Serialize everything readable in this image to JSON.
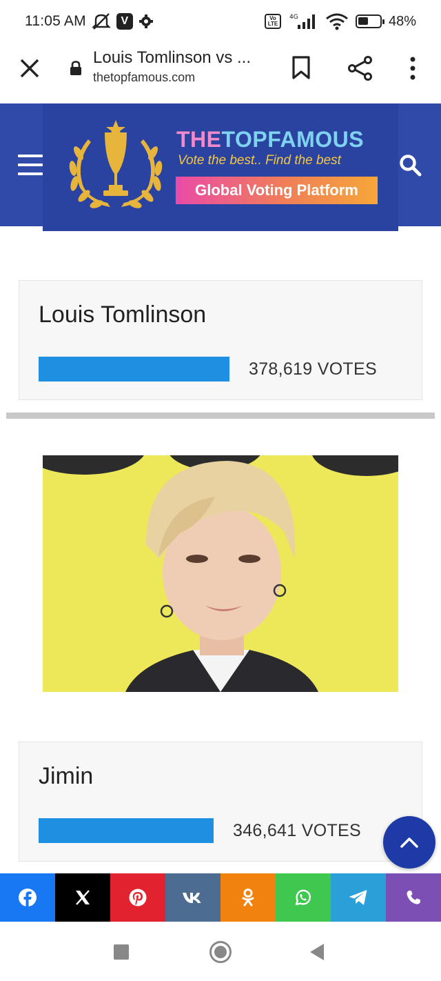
{
  "status_bar": {
    "time": "11:05 AM",
    "network": "4G",
    "battery": "48%",
    "battery_level": 0.48,
    "icons": [
      "mute-icon",
      "v-app-icon",
      "settings-icon",
      "volte-icon",
      "signal-icon",
      "wifi-icon",
      "battery-icon"
    ]
  },
  "browser": {
    "page_title": "Louis Tomlinson vs ...",
    "domain": "thetopfamous.com",
    "icons": [
      "close-icon",
      "lock-icon",
      "bookmark-icon",
      "share-icon",
      "more-vert-icon"
    ]
  },
  "site_header": {
    "brand_the": "THE",
    "brand_rest": "TOPFAMOUS",
    "tagline": "Vote the best.. Find the best",
    "badge": "Global Voting Platform",
    "colors": {
      "header_bg": "#2f4aa8",
      "vote_bar": "#1e8fe1"
    }
  },
  "contestants": [
    {
      "name": "Louis Tomlinson",
      "votes": "378,619 VOTES",
      "bar_fraction": 1.0
    },
    {
      "name": "Jimin",
      "votes": "346,641 VOTES",
      "bar_fraction": 0.9155
    }
  ],
  "share_bar": [
    {
      "name": "facebook",
      "color": "#1877f2"
    },
    {
      "name": "x",
      "color": "#000000"
    },
    {
      "name": "pinterest",
      "color": "#e0232f"
    },
    {
      "name": "vk",
      "color": "#4c6c91"
    },
    {
      "name": "odnoklassniki",
      "color": "#f2820f"
    },
    {
      "name": "whatsapp",
      "color": "#3fc84f"
    },
    {
      "name": "telegram",
      "color": "#2b9fd8"
    },
    {
      "name": "viber",
      "color": "#7b4fb4"
    }
  ]
}
